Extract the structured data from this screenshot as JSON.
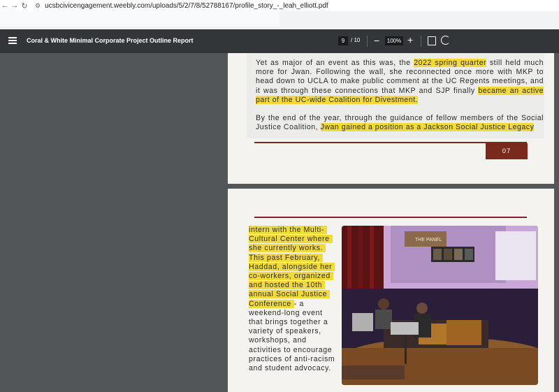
{
  "browser": {
    "url": "ucsbcivicengagement.weebly.com/uploads/5/2/7/8/52788167/profile_story_-_leah_elliott.pdf"
  },
  "toolbar": {
    "doc_title": "Coral & White Minimal Corporate Project Outline Report",
    "page_current": "9",
    "page_total": "/ 10",
    "zoom": "100%"
  },
  "page1": {
    "p1_a": "Yet as major of an event as this was, the ",
    "p1_hl1": "2022 spring quarter",
    "p1_b": " still held much more for Jwan. Following the wall, she reconnected once more with MKP to head down to UCLA to make public comment at the UC Regents meetings, and it was through these connections that MKP and SJP finally ",
    "p1_hl2": "became an active part of the UC-wide Coalition for Divestment.",
    "p2_a": "By the end of the year, through the guidance of fellow members of the Social Justice Coalition, ",
    "p2_hl": "Jwan gained a position as a Jackson Social Justice Legacy",
    "page_number": "07"
  },
  "page2": {
    "hl_lines": [
      "intern with the Multi-",
      "Cultural Center where",
      "she currently works.",
      "This past February,",
      "Haddad, alongside her",
      "co-workers, organized",
      "and hosted the 10th",
      "annual Social Justice",
      "Conference"
    ],
    "plain_after_hl": "- a",
    "plain_lines": [
      "weekend-long event",
      "that brings together a",
      "variety of speakers,",
      "workshops, and",
      "activities to encourage",
      "practices of anti-racism",
      "and student advocacy."
    ],
    "photo_sign": "THE PANEL"
  },
  "colors": {
    "highlight": "#f2da3c",
    "accent": "#7a2a1c",
    "toolbar": "#323639",
    "viewer_bg": "#525659"
  }
}
